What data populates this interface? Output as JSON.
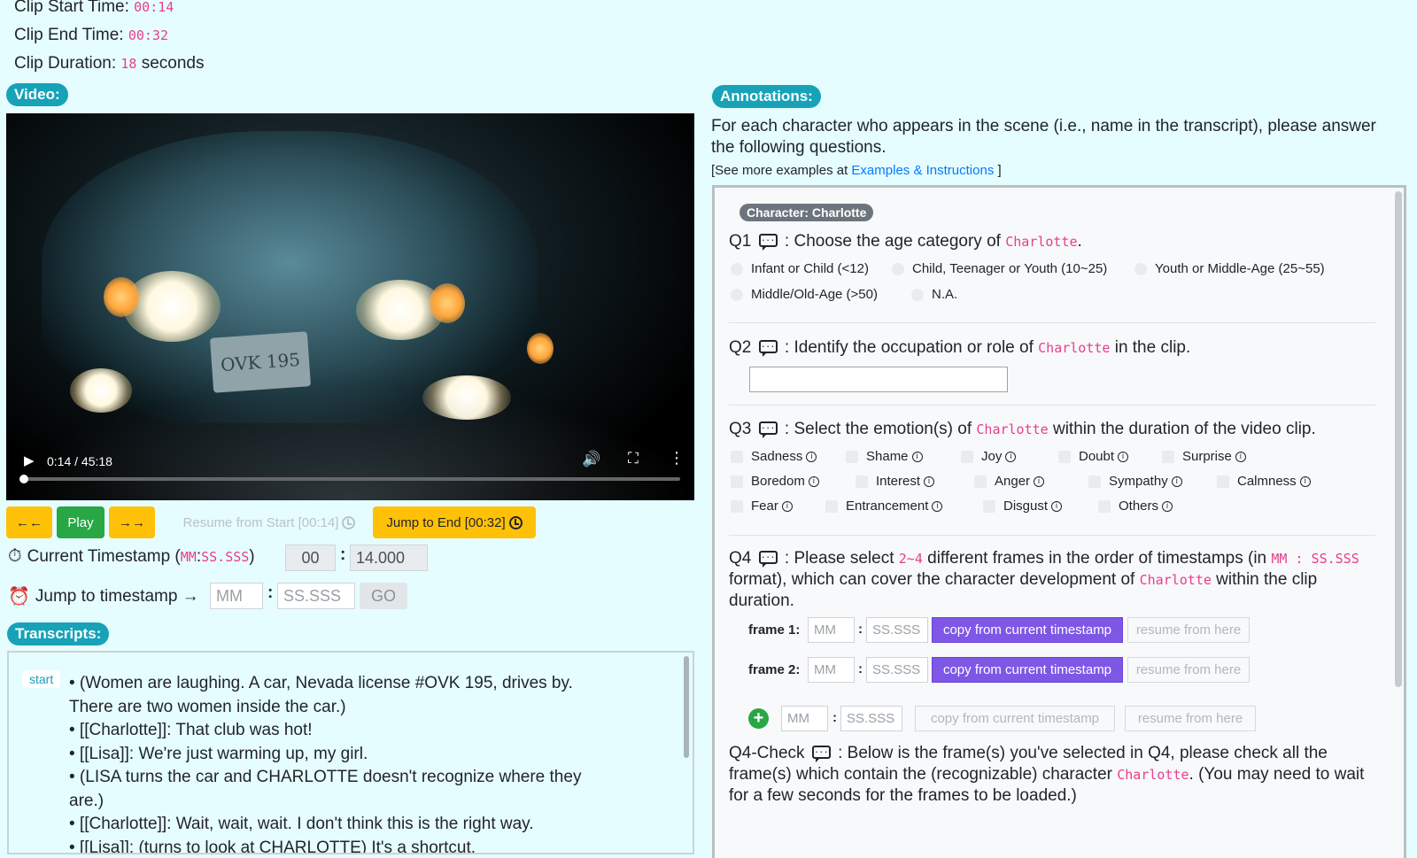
{
  "header": {
    "start_label": "Clip Start Time:",
    "start_value": "00:14",
    "end_label": "Clip End Time:",
    "end_value": "00:32",
    "duration_label": "Clip Duration:",
    "duration_value": "18",
    "duration_unit": "seconds"
  },
  "video_section": {
    "title": "Video:",
    "plate_text": "OVK 195",
    "time_display": "0:14 / 45:18",
    "progress": 0.005
  },
  "controls": {
    "back_label": "←←",
    "play_label": "Play",
    "forward_label": "→→",
    "resume_label": "Resume from Start [00:14]",
    "jump_end_label": "Jump to End [00:32]"
  },
  "current_timestamp": {
    "label": "Current Timestamp (",
    "format_mm": "MM",
    "format_sep": " : ",
    "format_ss": "SS.SSS",
    "close": ")",
    "mm_value": "00",
    "ss_value": "14.000"
  },
  "jump_timestamp": {
    "label": "Jump to timestamp →",
    "mm_placeholder": "MM",
    "ss_placeholder": "SS.SSS",
    "go_label": "GO"
  },
  "transcripts": {
    "title": "Transcripts:",
    "start_badge": "start",
    "lines": [
      "• (Women are laughing. A car, Nevada license #OVK 195, drives by. There are two women inside the car.)",
      "• [[Charlotte]]: That club was hot!",
      "• [[Lisa]]: We're just warming up, my girl.",
      "• (LISA turns the car and CHARLOTTE doesn't recognize where they are.)",
      "• [[Charlotte]]: Wait, wait, wait. I don't think this is the right way.",
      "• [[Lisa]]: (turns to look at CHARLOTTE) It's a shortcut."
    ]
  },
  "annotations": {
    "title": "Annotations:",
    "intro": "For each character who appears in the scene (i.e., name in the transcript), please answer the following questions.",
    "see_more_prefix": "[See more examples at ",
    "see_more_link": "Examples & Instructions",
    "see_more_suffix": " ]"
  },
  "character": {
    "badge": "Character: Charlotte",
    "name": "Charlotte"
  },
  "q1": {
    "prefix": "Q1",
    "text": " : Choose the age category of ",
    "suffix": ".",
    "options": [
      "Infant or Child (<12)",
      "Child, Teenager or Youth (10~25)",
      "Youth or Middle-Age (25~55)",
      "Middle/Old-Age (>50)",
      "N.A."
    ]
  },
  "q2": {
    "prefix": "Q2",
    "text": " : Identify the occupation or role of ",
    "suffix": " in the clip."
  },
  "q3": {
    "prefix": "Q3",
    "text": " : Select the emotion(s) of ",
    "suffix": " within the duration of the video clip.",
    "emotions": [
      "Sadness",
      "Shame",
      "Joy",
      "Doubt",
      "Surprise",
      "Boredom",
      "Interest",
      "Anger",
      "Sympathy",
      "Calmness",
      "Fear",
      "Entrancement",
      "Disgust",
      "Others"
    ]
  },
  "q4": {
    "prefix": "Q4",
    "text1": " : Please select ",
    "range": "2~4",
    "text2": " different frames in the order of timestamps (in ",
    "fmt": "MM : SS.SSS",
    "text3": " format), which can cover the character development of ",
    "text4": " within the clip duration.",
    "frame1_label": "frame 1:",
    "frame2_label": "frame 2:",
    "mm_placeholder": "MM",
    "ss_placeholder": "SS.SSS",
    "copy_label": "copy from current timestamp",
    "resume_label": "resume from here"
  },
  "q4check": {
    "prefix": "Q4-Check",
    "text1": " : Below is the frame(s) you've selected in Q4, please check all the frame(s) which contain the (recognizable) character ",
    "text2": ". (You may need to wait for a few seconds for the frames to be loaded.)"
  }
}
